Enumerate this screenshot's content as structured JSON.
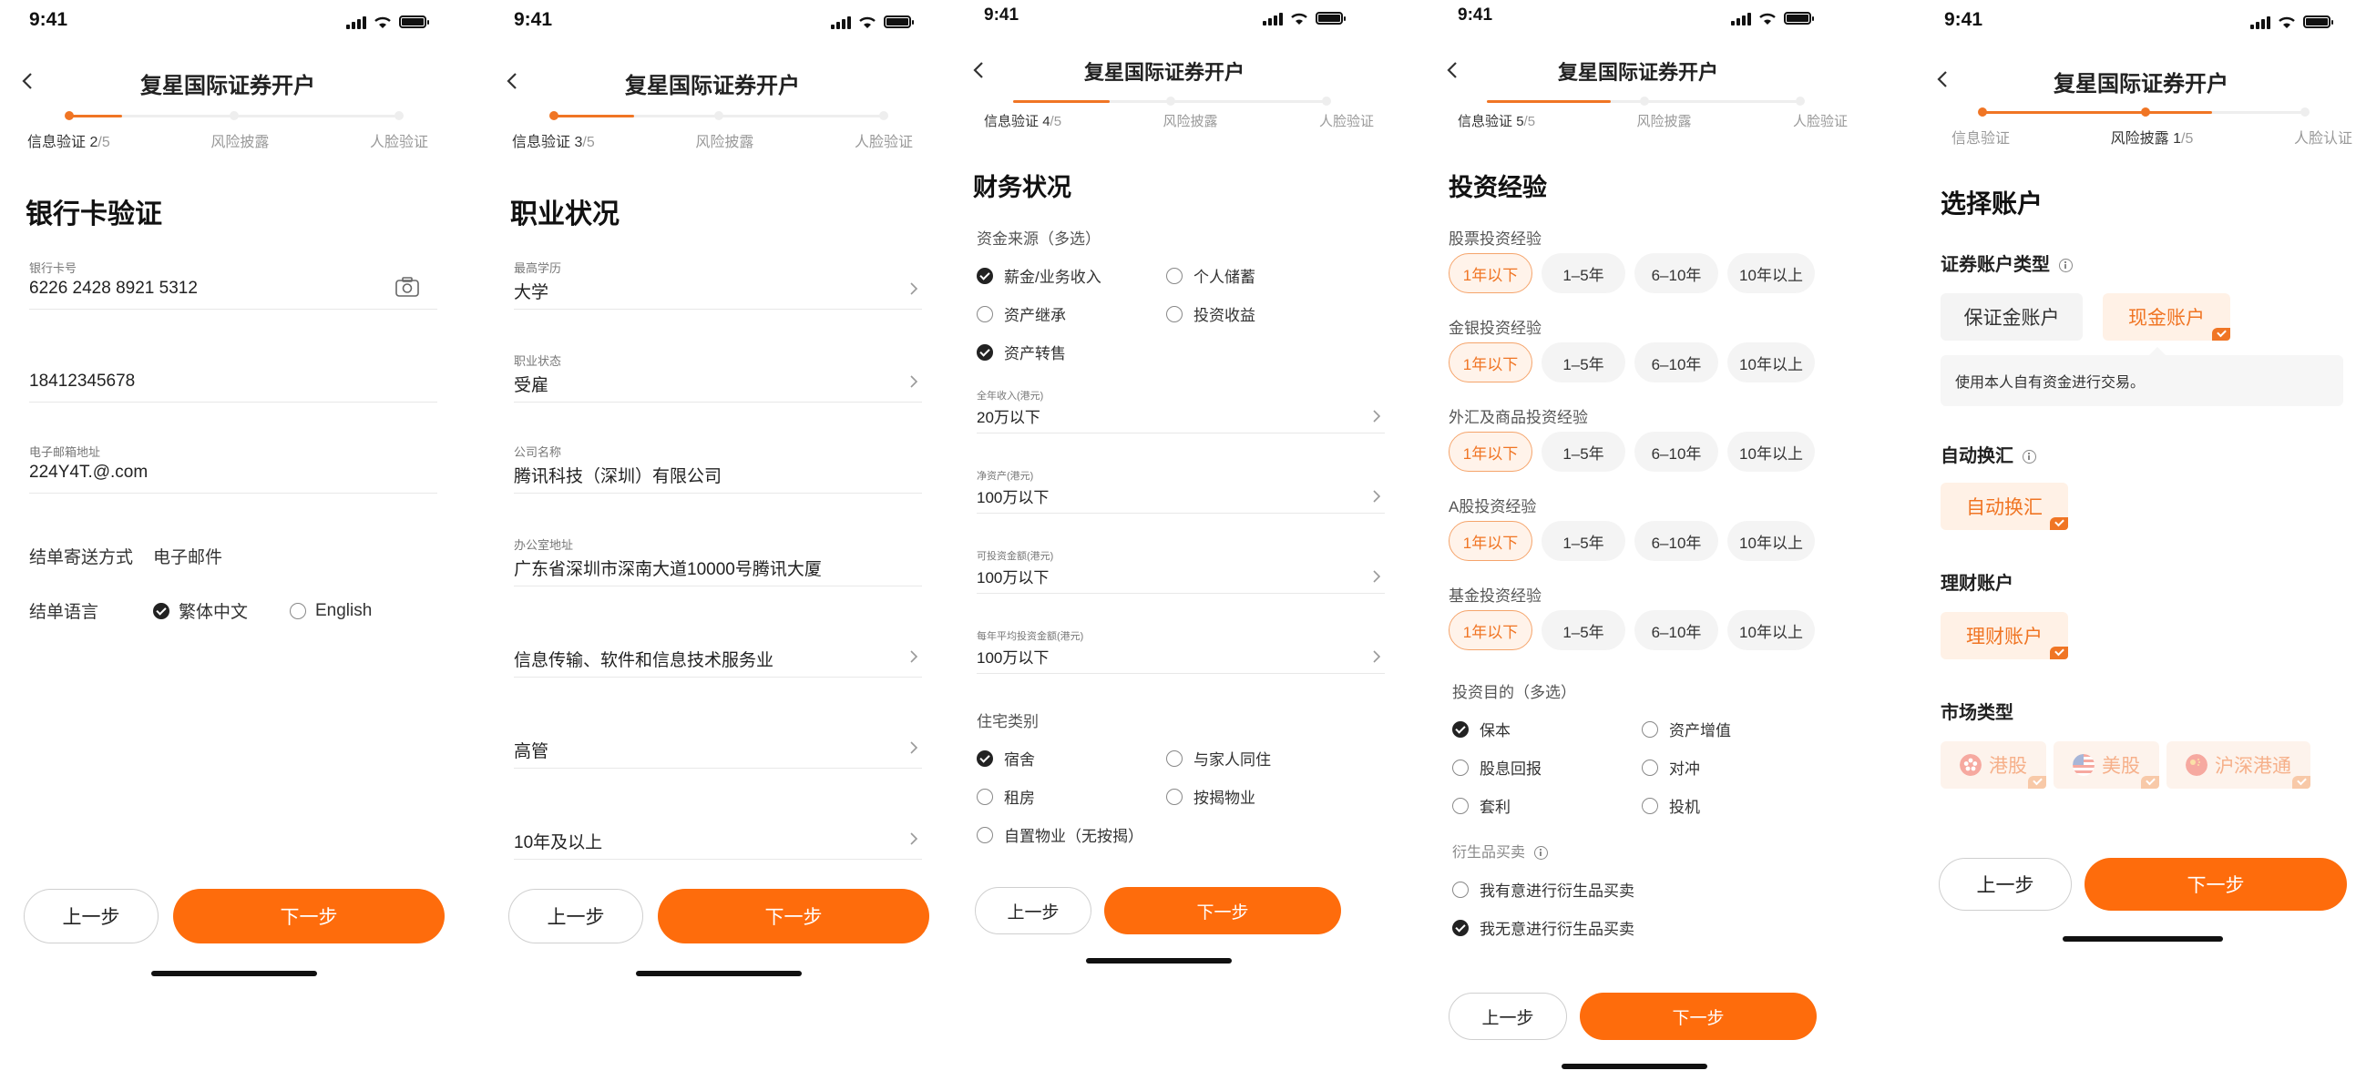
{
  "status_time": "9:41",
  "screens": [
    {
      "title": "复星国际证券开户",
      "steps": [
        {
          "label": "信息验证",
          "cur": "2",
          "tot": "/5"
        },
        {
          "label": "风险披露"
        },
        {
          "label": "人脸验证"
        }
      ],
      "heading": "银行卡验证",
      "fields": [
        {
          "label": "银行卡号",
          "value": "6226 2428 8921 5312"
        },
        {
          "label": "",
          "value": "18412345678"
        },
        {
          "label": "电子邮箱地址",
          "value": "224Y4T.@.com"
        }
      ],
      "delivery_label": "结单寄送方式",
      "delivery_value": "电子邮件",
      "lang_label": "结单语言",
      "lang_options": [
        "繁体中文",
        "English"
      ],
      "prev": "上一步",
      "next": "下一步"
    },
    {
      "title": "复星国际证券开户",
      "steps": [
        {
          "label": "信息验证",
          "cur": "3",
          "tot": "/5"
        },
        {
          "label": "风险披露"
        },
        {
          "label": "人脸验证"
        }
      ],
      "heading": "职业状况",
      "fields": [
        {
          "label": "最高学历",
          "value": "大学"
        },
        {
          "label": "职业状态",
          "value": "受雇"
        },
        {
          "label": "公司名称",
          "value": "腾讯科技（深圳）有限公司"
        },
        {
          "label": "办公室地址",
          "value": "广东省深圳市深南大道10000号腾讯大厦"
        },
        {
          "label": "",
          "value": "信息传输、软件和信息技术服务业"
        },
        {
          "label": "",
          "value": "高管"
        },
        {
          "label": "",
          "value": "10年及以上"
        }
      ],
      "prev": "上一步",
      "next": "下一步"
    },
    {
      "title": "复星国际证券开户",
      "steps": [
        {
          "label": "信息验证",
          "cur": "4",
          "tot": "/5"
        },
        {
          "label": "风险披露"
        },
        {
          "label": "人脸验证"
        }
      ],
      "heading": "财务状况",
      "fund_label": "资金来源（多选）",
      "fund_options": [
        "薪金/业务收入",
        "个人储蓄",
        "资产继承",
        "投资收益",
        "资产转售"
      ],
      "fields": [
        {
          "label": "全年收入(港元)",
          "value": "20万以下"
        },
        {
          "label": "净资产(港元)",
          "value": "100万以下"
        },
        {
          "label": "可投资金额(港元)",
          "value": "100万以下"
        },
        {
          "label": "每年平均投资金额(港元)",
          "value": "100万以下"
        }
      ],
      "house_label": "住宅类别",
      "house_options": [
        "宿舍",
        "与家人同住",
        "租房",
        "按揭物业",
        "自置物业（无按揭）"
      ],
      "prev": "上一步",
      "next": "下一步"
    },
    {
      "title": "复星国际证券开户",
      "steps": [
        {
          "label": "信息验证",
          "cur": "5",
          "tot": "/5"
        },
        {
          "label": "风险披露"
        },
        {
          "label": "人脸验证"
        }
      ],
      "heading": "投资经验",
      "exp_groups": [
        "股票投资经验",
        "金银投资经验",
        "外汇及商品投资经验",
        "A股投资经验",
        "基金投资经验"
      ],
      "exp_options": [
        "1年以下",
        "1–5年",
        "6–10年",
        "10年以上"
      ],
      "purpose_label": "投资目的（多选）",
      "purpose_options": [
        "保本",
        "资产增值",
        "股息回报",
        "对冲",
        "套利",
        "投机"
      ],
      "deriv_label": "衍生品买卖",
      "deriv_options": [
        "我有意进行衍生品买卖",
        "我无意进行衍生品买卖"
      ],
      "prev": "上一步",
      "next": "下一步"
    },
    {
      "title": "复星国际证券开户",
      "steps": [
        {
          "label": "信息验证"
        },
        {
          "label": "风险披露",
          "cur": "1",
          "tot": "/5"
        },
        {
          "label": "人脸认证"
        }
      ],
      "heading": "选择账户",
      "acct_type_label": "证券账户类型",
      "acct_types": [
        "保证金账户",
        "现金账户"
      ],
      "acct_tip": "使用本人自有资金进行交易。",
      "auto_label": "自动换汇",
      "auto_value": "自动换汇",
      "wealth_label": "理财账户",
      "wealth_value": "理财账户",
      "market_label": "市场类型",
      "markets": [
        "港股",
        "美股",
        "沪深港通"
      ],
      "prev": "上一步",
      "next": "下一步"
    }
  ],
  "colors": {
    "accent": "#fe6c0c",
    "progress": "#f07524"
  }
}
